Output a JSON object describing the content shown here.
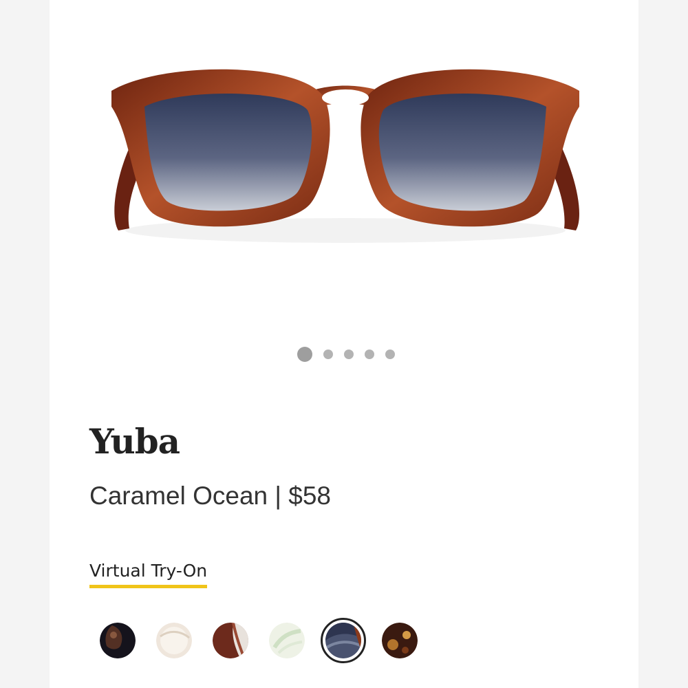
{
  "product": {
    "name": "Yuba",
    "variant_line": "Caramel Ocean | $58",
    "frame_color": "#8a3a1c",
    "lens_color": "#3f4a6a"
  },
  "gallery": {
    "slides": 5,
    "active_index": 0
  },
  "virtual_try_on": {
    "label": "Virtual Try-On",
    "underline_color": "#f0c419"
  },
  "swatches": [
    {
      "icon": "black-tortoise-swatch",
      "selected": false
    },
    {
      "icon": "clear-cream-swatch",
      "selected": false
    },
    {
      "icon": "brown-tortoise-swatch",
      "selected": false
    },
    {
      "icon": "clear-mint-swatch",
      "selected": false
    },
    {
      "icon": "caramel-ocean-swatch",
      "selected": true
    },
    {
      "icon": "dark-tortoise-swatch",
      "selected": false
    }
  ]
}
